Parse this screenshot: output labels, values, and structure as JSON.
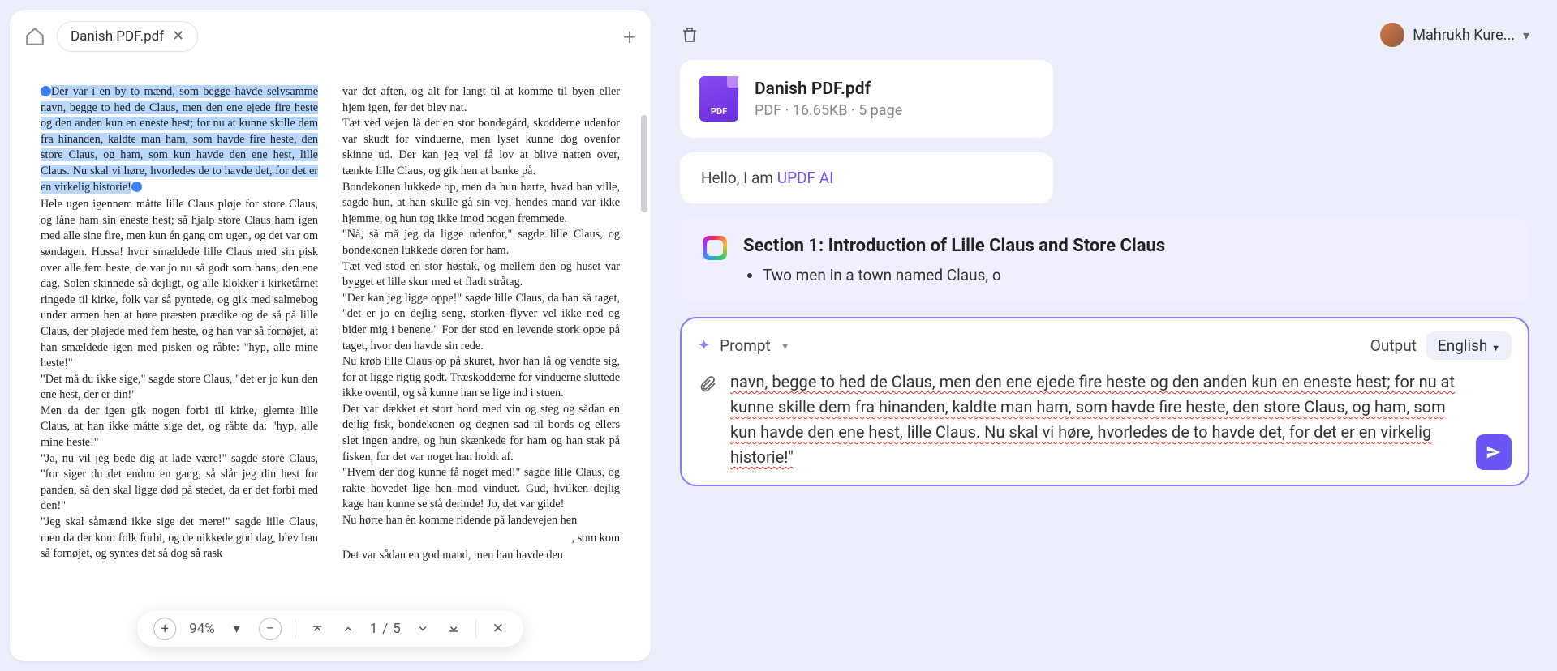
{
  "tab": {
    "title": "Danish PDF.pdf"
  },
  "document": {
    "highlighted": "Der var i en by to mænd, som begge havde selvsamme navn, begge to hed de Claus, men den ene ejede fire heste og den anden kun en eneste hest; for nu at kunne skille dem fra hinanden, kaldte man ham, som havde fire heste, den store Claus, og ham, som kun havde den ene hest, lille Claus. Nu skal vi høre, hvorledes de to havde det, for det er en virkelig historie!",
    "col1_rest": "Hele ugen igennem måtte lille Claus pløje for store Claus, og låne ham sin eneste hest; så hjalp store Claus ham igen med alle sine fire, men kun én gang om ugen, og det var om søndagen. Hussa! hvor smældede lille Claus med sin pisk over alle fem heste, de var jo nu så godt som hans, den ene dag. Solen skinnede så dejligt, og alle klokker i kirketårnet ringede til kirke, folk var så pyntede, og gik med salmebog under armen hen at høre præsten prædike og de så på lille Claus, der pløjede med fem heste, og han var så fornøjet, at han smældede igen med pisken og råbte: \"hyp, alle mine heste!\"\n\"Det må du ikke sige,\" sagde store Claus, \"det er jo kun den ene hest, der er din!\"\nMen da der igen gik nogen forbi til kirke, glemte lille Claus, at han ikke måtte sige det, og råbte da: \"hyp, alle mine heste!\"\n\"Ja, nu vil jeg bede dig at lade være!\" sagde store Claus, \"for siger du det endnu en gang, så slår jeg din hest for panden, så den skal ligge død på stedet, da er det forbi med den!\"\n\"Jeg skal såmænd ikke sige det mere!\" sagde lille Claus, men da der kom folk forbi, og de nikkede god dag, blev han så fornøjet, og syntes det så dog så rask",
    "col2": "var det aften, og alt for langt til at komme til byen eller hjem igen, før det blev nat.\nTæt ved vejen lå der en stor bondegård, skodderne udenfor var skudt for vinduerne, men lyset kunne dog ovenfor skinne ud. Der kan jeg vel få lov at blive natten over, tænkte lille Claus, og gik hen at banke på.\nBondekonen lukkede op, men da hun hørte, hvad han ville, sagde hun, at han skulle gå sin vej, hendes mand var ikke hjemme, og hun tog ikke imod nogen fremmede.\n\"Nå, så må jeg da ligge udenfor,\" sagde lille Claus, og bondekonen lukkede døren for ham.\nTæt ved stod en stor høstak, og mellem den og huset var bygget et lille skur med et fladt stråtag.\n\"Der kan jeg ligge oppe!\" sagde lille Claus, da han så taget, \"det er jo en dejlig seng, storken flyver vel ikke ned og bider mig i benene.\" For der stod en levende stork oppe på taget, hvor den havde sin rede.\nNu krøb lille Claus op på skuret, hvor han lå og vendte sig, for at ligge rigtig godt. Træskodderne for vinduerne sluttede ikke oventil, og så kunne han se lige ind i stuen.\nDer var dækket et stort bord med vin og steg og sådan en dejlig fisk, bondekonen og degnen sad til bords og ellers slet ingen andre, og hun skænkede for ham og han stak på fisken, for det var noget han holdt af.\n\"Hvem der dog kunne få noget med!\" sagde lille Claus, og rakte hovedet lige hen mod vinduet. Gud, hvilken dejlig kage han kunne se stå derinde! Jo, det var gilde!\nNu hørte han én komme ridende på landevejen hen",
    "col2_tail": ", som kom",
    "col2_tail2": "Det var sådan en god mand, men han havde den"
  },
  "toolbar": {
    "zoom": "94%",
    "page_current": "1",
    "page_sep": "/",
    "page_total": "5"
  },
  "user": {
    "name": "Mahrukh Kure..."
  },
  "attachment": {
    "title": "Danish PDF.pdf",
    "meta": "PDF · 16.65KB · 5 page"
  },
  "greeting": {
    "prefix": "Hello, I am ",
    "brand": "UPDF AI"
  },
  "ai_section": {
    "title": "Section 1: Introduction of Lille Claus and Store Claus",
    "bullet": "Two men in a town named Claus, o"
  },
  "prompt": {
    "label": "Prompt",
    "output_label": "Output",
    "language": "English",
    "text": "navn, begge to hed de Claus, men den ene ejede fire heste og den anden kun en eneste hest; for nu at kunne skille dem fra hinanden, kaldte man ham, som havde fire heste, den store Claus, og ham, som kun havde den ene hest, lille Claus. Nu skal vi høre, hvorledes de to havde det, for det er en virkelig historie!\""
  },
  "icons": {
    "pdf": "PDF"
  }
}
